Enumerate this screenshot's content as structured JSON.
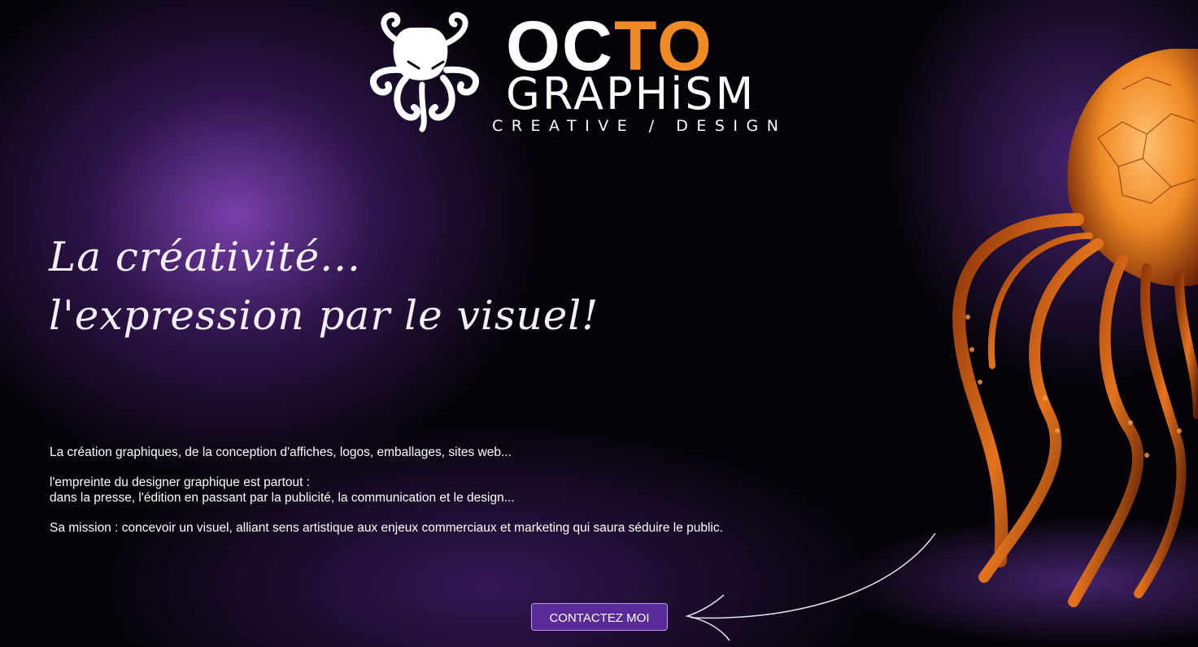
{
  "logo": {
    "word_top": "OCTO",
    "word_main": "GRAPHiSM",
    "tagline": "CREATIVE / DESIGN",
    "mark_icon": "octopus-logo-icon"
  },
  "hero": {
    "headline_line1": "La créativité...",
    "headline_line2": "l'expression par le visuel!"
  },
  "body": {
    "p1": "La création graphiques, de la conception d'affiches, logos, emballages, sites web...",
    "p2_line1": "l'empreinte du designer graphique est partout :",
    "p2_line2": "dans la presse, l'édition en passant par la publicité, la communication et le design...",
    "p3": "Sa mission : concevoir un visuel, alliant sens artistique aux enjeux commerciaux et marketing qui saura séduire le public."
  },
  "cta": {
    "label": "CONTACTEZ MOI"
  },
  "decor": {
    "arrow_icon": "curved-arrow-icon",
    "hero_image": "orange-octopus-illustration"
  },
  "colors": {
    "accent": "#f08a24",
    "button": "#5a2a99",
    "background": "#050308",
    "glow": "#8c4bc8"
  }
}
